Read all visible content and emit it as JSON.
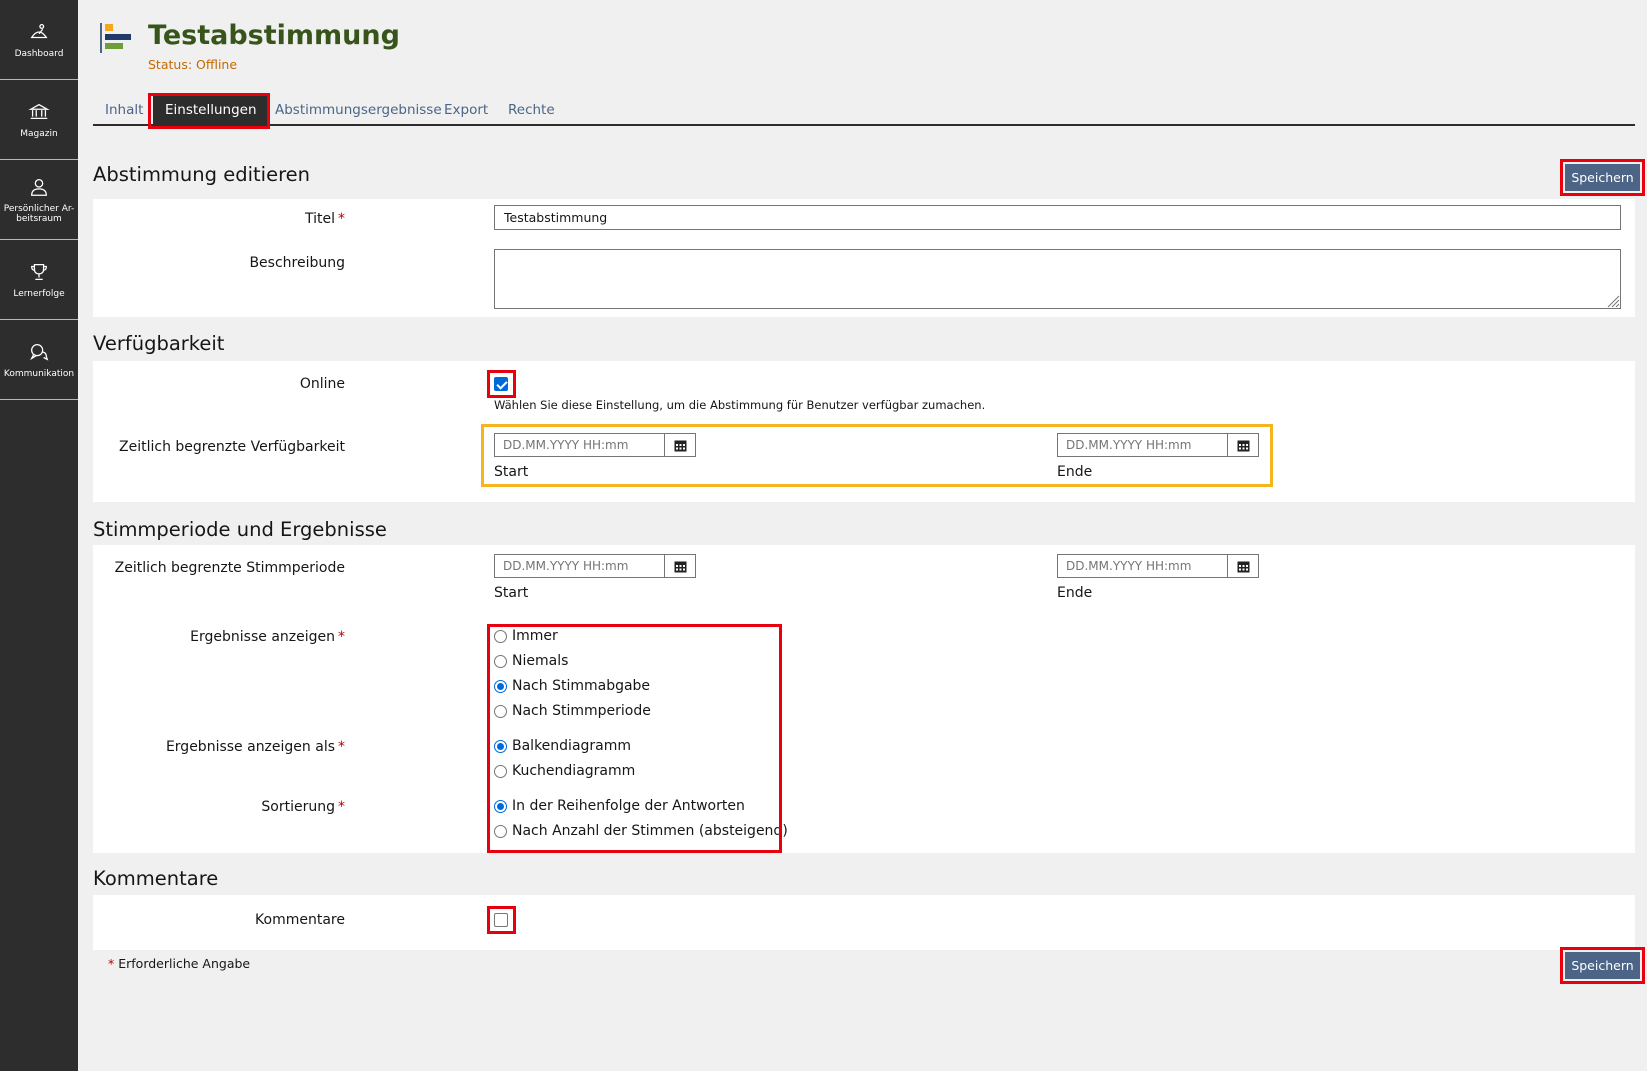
{
  "sidebar": {
    "items": [
      {
        "label": "Dashboard",
        "icon": "dashboard-icon"
      },
      {
        "label": "Magazin",
        "icon": "bank-icon"
      },
      {
        "label": "Persönlicher Ar-beitsraum",
        "icon": "user-icon"
      },
      {
        "label": "Lernerfolge",
        "icon": "trophy-icon"
      },
      {
        "label": "Kommunikation",
        "icon": "chat-icon"
      }
    ]
  },
  "header": {
    "title": "Testabstimmung",
    "status": "Status: Offline"
  },
  "tabs": [
    "Inhalt",
    "Einstellungen",
    "Abstimmungsergebnisse",
    "Export",
    "Rechte"
  ],
  "active_tab": "Einstellungen",
  "edit_section": {
    "heading": "Abstimmung editieren",
    "save_label": "Speichern",
    "title_label": "Titel",
    "title_value": "Testabstimmung",
    "description_label": "Beschreibung",
    "description_value": ""
  },
  "availability": {
    "heading": "Verfügbarkeit",
    "online_label": "Online",
    "online_checked": true,
    "online_hint": "Wählen Sie diese Einstellung, um die Abstimmung für Benutzer verfügbar zumachen.",
    "limited_label": "Zeitlich begrenzte Verfügbarkeit",
    "start_placeholder": "DD.MM.YYYY HH:mm",
    "end_placeholder": "DD.MM.YYYY HH:mm",
    "start_label": "Start",
    "end_label": "Ende"
  },
  "voting": {
    "heading": "Stimmperiode und Ergebnisse",
    "period_label": "Zeitlich begrenzte Stimmperiode",
    "start_placeholder": "DD.MM.YYYY HH:mm",
    "end_placeholder": "DD.MM.YYYY HH:mm",
    "start_label": "Start",
    "end_label": "Ende",
    "show_results_label": "Ergebnisse anzeigen",
    "show_results_options": [
      "Immer",
      "Niemals",
      "Nach Stimmabgabe",
      "Nach Stimmperiode"
    ],
    "show_results_selected": "Nach Stimmabgabe",
    "show_as_label": "Ergebnisse anzeigen als",
    "show_as_options": [
      "Balkendiagramm",
      "Kuchendiagramm"
    ],
    "show_as_selected": "Balkendiagramm",
    "sort_label": "Sortierung",
    "sort_options": [
      "In der Reihenfolge der Antworten",
      "Nach Anzahl der Stimmen (absteigend)"
    ],
    "sort_selected": "In der Reihenfolge der Antworten"
  },
  "comments": {
    "heading": "Kommentare",
    "label": "Kommentare",
    "checked": false
  },
  "footer": {
    "required_star": "*",
    "required_note": "Erforderliche Angabe",
    "save_label": "Speichern"
  },
  "colors": {
    "sidebar": "#2d2d2d",
    "title": "#37551b",
    "status": "#c46a00",
    "button": "#4c6586",
    "annotation_red": "#e8000e",
    "annotation_yellow": "#f6b51e"
  }
}
